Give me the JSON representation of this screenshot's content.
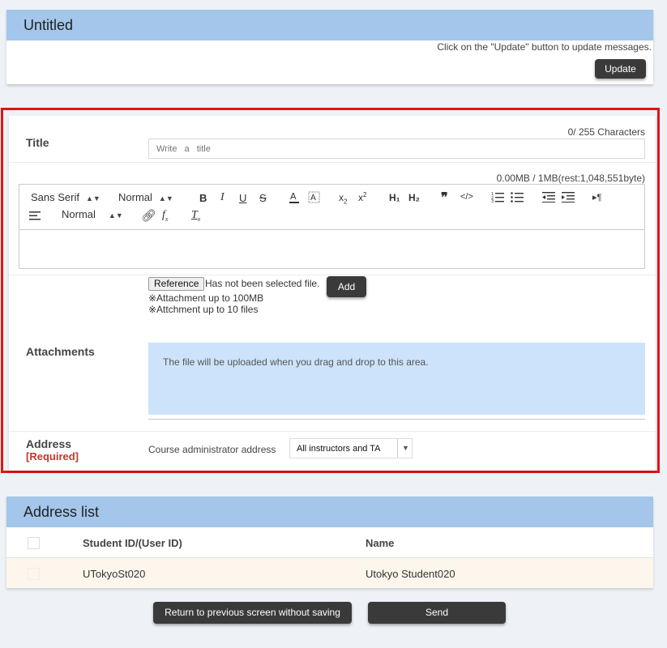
{
  "top": {
    "title": "Untitled",
    "hint": "Click on the \"Update\" button to update messages.",
    "update_label": "Update"
  },
  "form": {
    "title_label": "Title",
    "char_count": "0/ 255 Characters",
    "title_placeholder": "Write a title",
    "size_info": "0.00MB / 1MB(rest:1,048,551byte)",
    "toolbar": {
      "font": "Sans Serif",
      "size": "Normal",
      "heading": "Normal",
      "bold": "B",
      "italic": "I",
      "underline": "U",
      "strike": "S",
      "h1": "H₁",
      "h2": "H₂"
    },
    "attachments_label": "Attachments",
    "reference_label": "Reference",
    "no_file_text": "Has not been selected file.",
    "add_label": "Add",
    "note_size": "※Attachment up to 100MB",
    "note_count": "※Attchment up to 10 files",
    "dropzone_text": "The file will be uploaded when you drag and drop to this area.",
    "address_label": "Address",
    "address_required": "[Required]",
    "address_field_label": "Course administrator address",
    "address_value": "All instructors and TA"
  },
  "address_list": {
    "title": "Address list",
    "columns": {
      "id": "Student ID/(User ID)",
      "name": "Name"
    },
    "rows": [
      {
        "id": "UTokyoSt020",
        "name": "Utokyo Student020"
      }
    ]
  },
  "actions": {
    "return_label": "Return to previous screen without saving",
    "send_label": "Send"
  }
}
